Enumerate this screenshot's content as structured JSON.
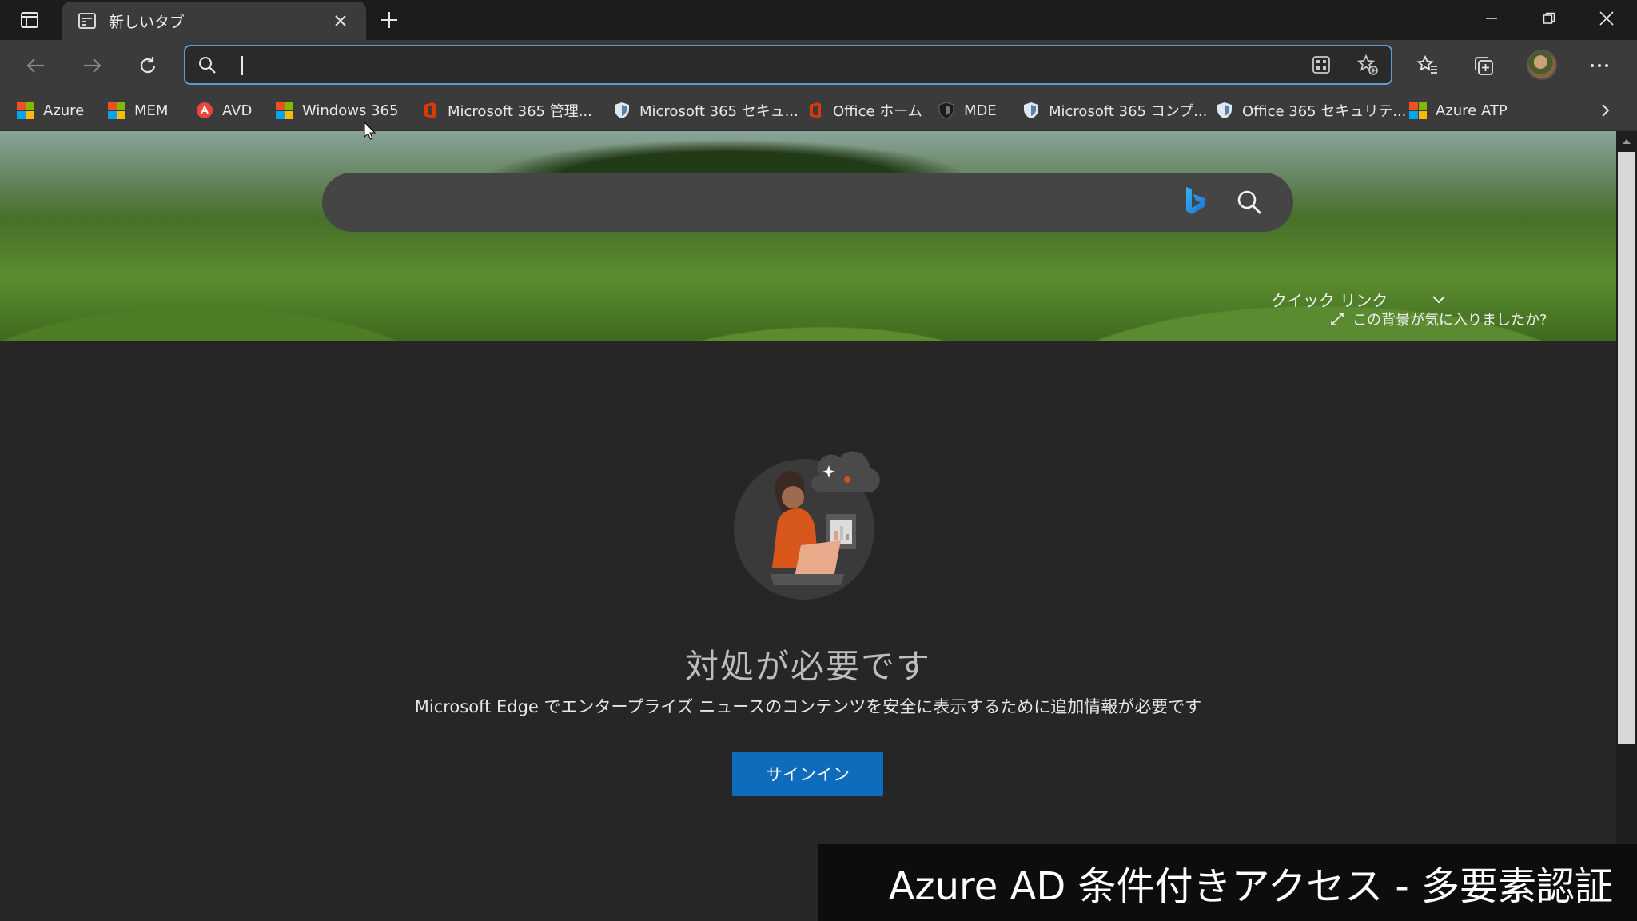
{
  "tab": {
    "title": "新しいタブ"
  },
  "omnibox": {
    "value": "",
    "placeholder": ""
  },
  "favorites": [
    {
      "label": "Azure",
      "icon": "microsoft-logo-icon"
    },
    {
      "label": "MEM",
      "icon": "microsoft-logo-icon"
    },
    {
      "label": "AVD",
      "icon": "avd-icon"
    },
    {
      "label": "Windows 365",
      "icon": "microsoft-logo-icon"
    },
    {
      "label": "Microsoft 365 管理...",
      "icon": "office-icon"
    },
    {
      "label": "Microsoft 365 セキュ...",
      "icon": "shield-icon"
    },
    {
      "label": "Office ホーム",
      "icon": "office-icon"
    },
    {
      "label": "MDE",
      "icon": "defender-shield-icon"
    },
    {
      "label": "Microsoft 365 コンプ...",
      "icon": "shield-icon"
    },
    {
      "label": "Office 365 セキュリテ...",
      "icon": "shield-icon"
    },
    {
      "label": "Azure ATP",
      "icon": "microsoft-logo-icon"
    }
  ],
  "hero": {
    "quick_links": "クイック リンク",
    "like_background": "この背景が気に入りましたか?"
  },
  "main": {
    "title": "対処が必要です",
    "description": "Microsoft Edge でエンタープライズ ニュースのコンテンツを安全に表示するために追加情報が必要です",
    "signin_label": "サインイン"
  },
  "caption": "Azure AD 条件付きアクセス - 多要素認証",
  "colors": {
    "accent": "#0f6cbd",
    "omnibox_border": "#5d9bd8",
    "toolbar": "#3b3b3b"
  }
}
